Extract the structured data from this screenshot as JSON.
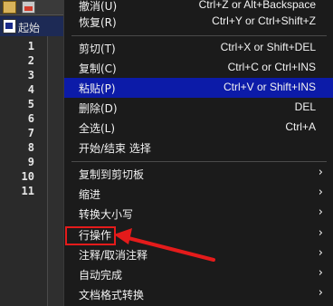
{
  "editor": {
    "tab_text": "起始",
    "line_numbers": [
      "1",
      "2",
      "3",
      "4",
      "5",
      "6",
      "7",
      "8",
      "9",
      "10",
      "11"
    ]
  },
  "menu": {
    "items": [
      {
        "label": "撤消(U)",
        "shortcut": "Ctrl+Z or Alt+Backspace"
      },
      {
        "label": "恢复(R)",
        "shortcut": "Ctrl+Y or Ctrl+Shift+Z"
      },
      {
        "label": "剪切(T)",
        "shortcut": "Ctrl+X or Shift+DEL"
      },
      {
        "label": "复制(C)",
        "shortcut": "Ctrl+C or Ctrl+INS"
      },
      {
        "label": "粘贴(P)",
        "shortcut": "Ctrl+V or Shift+INS",
        "selected": true
      },
      {
        "label": "删除(D)",
        "shortcut": "DEL"
      },
      {
        "label": "全选(L)",
        "shortcut": "Ctrl+A"
      },
      {
        "label": "开始/结束 选择",
        "shortcut": ""
      },
      {
        "label": "复制到剪切板",
        "submenu": true
      },
      {
        "label": "缩进",
        "submenu": true
      },
      {
        "label": "转换大小写",
        "submenu": true
      },
      {
        "label": "行操作",
        "submenu": true,
        "highlighted": true
      },
      {
        "label": "注释/取消注释",
        "submenu": true
      },
      {
        "label": "自动完成",
        "submenu": true
      },
      {
        "label": "文档格式转换",
        "submenu": true
      }
    ],
    "submenu_arrow": "›"
  },
  "colors": {
    "menu_bg": "#1b1b1b",
    "selected_bg": "#0c1ba8",
    "annotation": "#e41b1b"
  },
  "icons": {
    "toolbar": [
      "open-folder-icon",
      "save-icon"
    ],
    "tab": "document-icon",
    "submenu": "chevron-right-icon"
  }
}
